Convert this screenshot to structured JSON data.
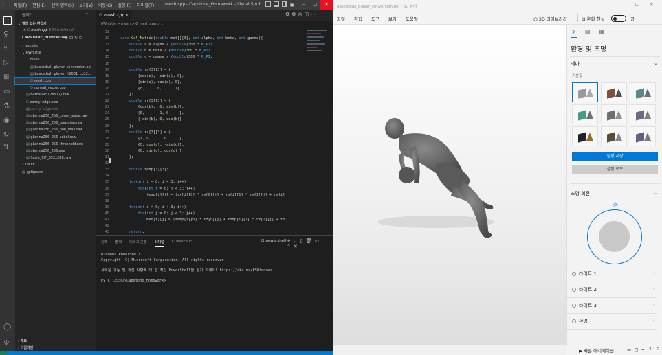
{
  "vscode": {
    "menu": [
      "파일(F)",
      "편집(E)",
      "선택 영역(S)",
      "보기(V)",
      "이동(G)",
      "실행(R)",
      "터미널(T)",
      "..."
    ],
    "window_title": "mesh.cpp - Capstone_Homework - Visual Studi...",
    "explorer_title": "탐색기",
    "open_editors_label": "열려 있는 편집기",
    "open_editor_file": "mesh.cpp",
    "open_editor_path": "6Whistle\\mesh",
    "project": "CAPSTONE_HOMEWORK",
    "tree": [
      {
        "name": ".vscode",
        "indent": 1,
        "kind": "folder"
      },
      {
        "name": "6Whistle",
        "indent": 1,
        "kind": "folder-open"
      },
      {
        "name": "mesh",
        "indent": 2,
        "kind": "folder-open"
      },
      {
        "name": "basketball_player_conversion.obj",
        "indent": 3,
        "kind": "file"
      },
      {
        "name": "basketball_player_fr0001_cp12...",
        "indent": 3,
        "kind": "file"
      },
      {
        "name": "mesh.cpp",
        "indent": 3,
        "kind": "cpp",
        "selected": true
      },
      {
        "name": "normal_vector.cpp",
        "indent": 3,
        "kind": "cpp"
      },
      {
        "name": "barbara(512x512).raw",
        "indent": 2,
        "kind": "file"
      },
      {
        "name": "canny_edge.cpp",
        "indent": 2,
        "kind": "cpp"
      },
      {
        "name": "canny_edge.exe",
        "indent": 2,
        "kind": "file",
        "dim": true
      },
      {
        "name": "gLenna256_256_canny_edge.raw",
        "indent": 2,
        "kind": "file"
      },
      {
        "name": "gLenna256_256_gaussian.raw",
        "indent": 2,
        "kind": "file"
      },
      {
        "name": "gLenna256_256_non_max.raw",
        "indent": 2,
        "kind": "file"
      },
      {
        "name": "gLenna256_256_sobel.raw",
        "indent": 2,
        "kind": "file"
      },
      {
        "name": "gLenna256_256_threshold.raw",
        "indent": 2,
        "kind": "file"
      },
      {
        "name": "gLenna256_256.raw",
        "indent": 2,
        "kind": "file"
      },
      {
        "name": "Suzie_CIF_352x288.raw",
        "indent": 2,
        "kind": "file"
      },
      {
        "name": "13LEE",
        "indent": 1,
        "kind": "folder"
      },
      {
        "name": ".gitignore",
        "indent": 1,
        "kind": "file"
      }
    ],
    "outline_label": "개요",
    "timeline_label": "타임라인",
    "tab_label": "mesh.cpp",
    "breadcrumb": "6Whistle > mesh > G mesh.cpp > ...",
    "code": [
      {
        "n": "11",
        "t": ""
      },
      {
        "n": "12",
        "t": "void Cal_Matrix(double mat[][3], int alpha, int beta, int gamma){"
      },
      {
        "n": "13",
        "t": "    double a = alpha / (double)360 * M_PI;"
      },
      {
        "n": "14",
        "t": "    double b = beta / (double)360 * M_PI;"
      },
      {
        "n": "15",
        "t": "    double c = gamma / (double)360 * M_PI;"
      },
      {
        "n": "16",
        "t": ""
      },
      {
        "n": "17",
        "t": "    double rx[3][3] = {"
      },
      {
        "n": "18",
        "t": "        {cos(a), -sin(a), 0},"
      },
      {
        "n": "19",
        "t": "        {sin(a), cos(a), 0},"
      },
      {
        "n": "20",
        "t": "        {0,      0,      1}"
      },
      {
        "n": "21",
        "t": "    };"
      },
      {
        "n": "22",
        "t": "    double ry[3][3] = {"
      },
      {
        "n": "23",
        "t": "        {cos(b),  0, sin(b)},"
      },
      {
        "n": "24",
        "t": "        {0,       1, 0     },"
      },
      {
        "n": "25",
        "t": "        {-sin(b), 0, cos(b)}"
      },
      {
        "n": "26",
        "t": "    };"
      },
      {
        "n": "27",
        "t": "    double rz[3][3] = {"
      },
      {
        "n": "28",
        "t": "        {1, 0,      0      },"
      },
      {
        "n": "29",
        "t": "        {0, cos(c), -sin(c)},"
      },
      {
        "n": "30",
        "t": "        {0, sin(c), cos(c) }"
      },
      {
        "n": "31",
        "t": "    };"
      },
      {
        "n": "32",
        "t": ""
      },
      {
        "n": "33",
        "t": "    double temp[3][3];"
      },
      {
        "n": "34",
        "t": ""
      },
      {
        "n": "35",
        "t": "    for(int i = 0; i < 3; i++)"
      },
      {
        "n": "36",
        "t": "        for(int j = 0; j < 3; j++)"
      },
      {
        "n": "37",
        "t": "            temp[i][j] = (rx[i][0] * ry[0][j] + rx[i][1] * ry[1][j] + rx[i]"
      },
      {
        "n": "38",
        "t": ""
      },
      {
        "n": "39",
        "t": "    for(int i = 0; i < 3; i++)"
      },
      {
        "n": "40",
        "t": "        for(int j = 0; j < 3; j++)"
      },
      {
        "n": "41",
        "t": "            mat[i][j] = (temp[i][0] * rz[0][j] + temp[i][1] * rz[1][j] + te"
      },
      {
        "n": "42",
        "t": ""
      },
      {
        "n": "43",
        "t": "    return;"
      }
    ],
    "panel_tabs": [
      "문제",
      "출력",
      "디버그 콘솔",
      "터미널",
      "COMMENTS"
    ],
    "active_panel_tab": "터미널",
    "terminal_shell": "powershell",
    "terminal_lines": [
      "Windows PowerShell",
      "Copyright (C) Microsoft Corporation. All rights reserved.",
      "",
      "새로운 기능 및 개선 사항에 대 한 최신 PowerShell을 설치 하세요! https://aka.ms/PSWindows",
      "",
      "PS C:\\스터디\\Capstone_Homework>"
    ]
  },
  "viewer": {
    "window_title": "basketball_player_conversion.obj - 3D 뷰어",
    "menu": [
      "파일",
      "편집",
      "도구",
      "보기",
      "도움말"
    ],
    "lib_label": "3D 라이브러리",
    "mr_label": "혼합 현실",
    "toggle_state": "끔",
    "panel_title": "환경 및 조명",
    "theme_label": "테마",
    "default_label": "기본값",
    "save_theme": "설정 저장",
    "load_theme": "설정 로드",
    "rotation_label": "조명 회전",
    "lights": [
      "라이트 1",
      "라이트 2",
      "라이트 3",
      "환경"
    ],
    "anim_label": "빠른 애니메이션",
    "zoom_label": "x 1.0",
    "accent": "#0078d7"
  }
}
